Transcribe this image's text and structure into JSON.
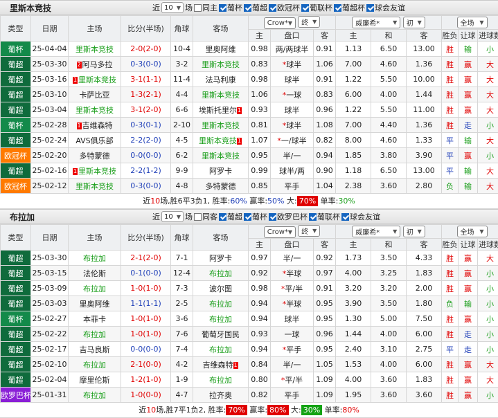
{
  "sections": [
    {
      "team": "里斯本竞技",
      "recent_label": "近",
      "recent_value": "10",
      "games_label": "场",
      "same_host": "同主",
      "leagues": [
        "葡杯",
        "葡超",
        "欧冠杯",
        "葡联杯",
        "葡超杯",
        "球会友谊"
      ],
      "league_checked": [
        true,
        true,
        true,
        true,
        true,
        true
      ],
      "same_checked": false,
      "headers": {
        "type": "类型",
        "date": "日期",
        "home": "主场",
        "score": "比分(半场)",
        "corner": "角球",
        "away": "客场",
        "win": "胜负",
        "handicap_res": "让球",
        "goals_res": "进球数",
        "crow": "Crow*",
        "crow_sel": "终",
        "will": "威廉希*",
        "will_sel": "初",
        "scope": "全场",
        "h": "主",
        "pan": "盘口",
        "k": "客",
        "zhu": "主",
        "he": "和",
        "ke": "客"
      },
      "rows": [
        {
          "type": "葡杯",
          "tc": "g-mid",
          "date": "25-04-04",
          "home": "里斯本竞技",
          "hr": "",
          "score": "2-0(2-0)",
          "sc": "r",
          "corner": "10-4",
          "away": "里奥阿维",
          "ar": "",
          "o1": "0.98",
          "pan": "两/两球半",
          "ps": false,
          "o2": "0.91",
          "w1": "1.13",
          "w2": "6.50",
          "w3": "13.00",
          "res": "胜",
          "rc": "r",
          "hd": "输",
          "hc": "gr",
          "g": "小",
          "gc": "gr",
          "hl": "home"
        },
        {
          "type": "葡超",
          "tc": "g-dark",
          "date": "25-03-30",
          "home": "阿马多拉",
          "hr": "2",
          "score": "0-3(0-0)",
          "sc": "b",
          "corner": "3-2",
          "away": "里斯本竞技",
          "ar": "",
          "o1": "0.83",
          "pan": "球半",
          "ps": true,
          "o2": "1.06",
          "w1": "7.00",
          "w2": "4.60",
          "w3": "1.36",
          "res": "胜",
          "rc": "r",
          "hd": "赢",
          "hc": "r",
          "g": "大",
          "gc": "r",
          "hl": "away"
        },
        {
          "type": "葡超",
          "tc": "g-dark",
          "date": "25-03-16",
          "home": "里斯本竞技",
          "hr": "1",
          "score": "3-1(1-1)",
          "sc": "r",
          "corner": "11-4",
          "away": "法马利康",
          "ar": "",
          "o1": "0.98",
          "pan": "球半",
          "ps": false,
          "o2": "0.91",
          "w1": "1.22",
          "w2": "5.50",
          "w3": "10.00",
          "res": "胜",
          "rc": "r",
          "hd": "赢",
          "hc": "r",
          "g": "大",
          "gc": "r",
          "hl": "home"
        },
        {
          "type": "葡超",
          "tc": "g-dark",
          "date": "25-03-10",
          "home": "卡萨比亚",
          "hr": "",
          "score": "1-3(2-1)",
          "sc": "r",
          "corner": "4-4",
          "away": "里斯本竞技",
          "ar": "",
          "o1": "1.06",
          "pan": "一球",
          "ps": true,
          "o2": "0.83",
          "w1": "6.00",
          "w2": "4.00",
          "w3": "1.44",
          "res": "胜",
          "rc": "r",
          "hd": "赢",
          "hc": "r",
          "g": "大",
          "gc": "r",
          "hl": "away"
        },
        {
          "type": "葡超",
          "tc": "g-dark",
          "date": "25-03-04",
          "home": "里斯本竞技",
          "hr": "",
          "score": "3-1(2-0)",
          "sc": "r",
          "corner": "6-6",
          "away": "埃斯托里尔",
          "ar": "1",
          "o1": "0.93",
          "pan": "球半",
          "ps": false,
          "o2": "0.96",
          "w1": "1.22",
          "w2": "5.50",
          "w3": "11.00",
          "res": "胜",
          "rc": "r",
          "hd": "赢",
          "hc": "r",
          "g": "大",
          "gc": "r",
          "hl": "home"
        },
        {
          "type": "葡杯",
          "tc": "g-mid",
          "date": "25-02-28",
          "home": "吉维森特",
          "hr": "1",
          "score": "0-3(0-1)",
          "sc": "b",
          "corner": "2-10",
          "away": "里斯本竞技",
          "ar": "",
          "o1": "0.81",
          "pan": "球半",
          "ps": true,
          "o2": "1.08",
          "w1": "7.00",
          "w2": "4.40",
          "w3": "1.36",
          "res": "胜",
          "rc": "r",
          "hd": "走",
          "hc": "b",
          "g": "小",
          "gc": "gr",
          "hl": "away"
        },
        {
          "type": "葡超",
          "tc": "g-dark",
          "date": "25-02-24",
          "home": "AVS俱乐部",
          "hr": "",
          "score": "2-2(2-0)",
          "sc": "b",
          "corner": "4-5",
          "away": "里斯本竞技",
          "ar": "1",
          "o1": "1.07",
          "pan": "一/球半",
          "ps": true,
          "o2": "0.82",
          "w1": "8.00",
          "w2": "4.60",
          "w3": "1.33",
          "res": "平",
          "rc": "b",
          "hd": "输",
          "hc": "gr",
          "g": "大",
          "gc": "r",
          "hl": "away"
        },
        {
          "type": "欧冠杯",
          "tc": "g-org",
          "date": "25-02-20",
          "home": "多特蒙德",
          "hr": "",
          "score": "0-0(0-0)",
          "sc": "b",
          "corner": "6-2",
          "away": "里斯本竞技",
          "ar": "",
          "o1": "0.95",
          "pan": "半/一",
          "ps": false,
          "o2": "0.94",
          "w1": "1.85",
          "w2": "3.80",
          "w3": "3.90",
          "res": "平",
          "rc": "b",
          "hd": "赢",
          "hc": "r",
          "g": "小",
          "gc": "gr",
          "hl": "away"
        },
        {
          "type": "葡超",
          "tc": "g-dark",
          "date": "25-02-16",
          "home": "里斯本竞技",
          "hr": "1",
          "score": "2-2(1-2)",
          "sc": "b",
          "corner": "9-9",
          "away": "阿罗卡",
          "ar": "",
          "o1": "0.99",
          "pan": "球半/两",
          "ps": false,
          "o2": "0.90",
          "w1": "1.18",
          "w2": "6.50",
          "w3": "13.00",
          "res": "平",
          "rc": "b",
          "hd": "输",
          "hc": "gr",
          "g": "大",
          "gc": "r",
          "hl": "home"
        },
        {
          "type": "欧冠杯",
          "tc": "g-org",
          "date": "25-02-12",
          "home": "里斯本竞技",
          "hr": "",
          "score": "0-3(0-0)",
          "sc": "b",
          "corner": "4-8",
          "away": "多特蒙德",
          "ar": "",
          "o1": "0.85",
          "pan": "平手",
          "ps": false,
          "o2": "1.04",
          "w1": "2.38",
          "w2": "3.60",
          "w3": "2.80",
          "res": "负",
          "rc": "gr",
          "hd": "输",
          "hc": "gr",
          "g": "大",
          "gc": "r",
          "hl": "home"
        }
      ],
      "summary": {
        "p1": "近",
        "n": "10",
        "p2": "场,胜6平3负1, 胜率:",
        "wr": "60%",
        "p3": " 赢率:",
        "yr": "50%",
        "p4": " 大:",
        "big": "70%",
        "p5": " 单率:",
        "sr": "30%"
      }
    },
    {
      "team": "布拉加",
      "recent_label": "近",
      "recent_value": "10",
      "games_label": "场",
      "same_host": "同客",
      "leagues": [
        "葡超",
        "葡杯",
        "欧罗巴杯",
        "葡联杯",
        "球会友谊"
      ],
      "league_checked": [
        true,
        true,
        true,
        true,
        true
      ],
      "same_checked": false,
      "headers": {
        "type": "类型",
        "date": "日期",
        "home": "主场",
        "score": "比分(半场)",
        "corner": "角球",
        "away": "客场",
        "win": "胜负",
        "handicap_res": "让球",
        "goals_res": "进球数",
        "crow": "Crow*",
        "crow_sel": "终",
        "will": "威廉希*",
        "will_sel": "初",
        "scope": "全场",
        "h": "主",
        "pan": "盘口",
        "k": "客",
        "zhu": "主",
        "he": "和",
        "ke": "客"
      },
      "rows": [
        {
          "type": "葡超",
          "tc": "g-dark",
          "date": "25-03-30",
          "home": "布拉加",
          "hr": "",
          "score": "2-1(2-0)",
          "sc": "r",
          "corner": "7-1",
          "away": "阿罗卡",
          "ar": "",
          "o1": "0.97",
          "pan": "半/一",
          "ps": false,
          "o2": "0.92",
          "w1": "1.73",
          "w2": "3.50",
          "w3": "4.33",
          "res": "胜",
          "rc": "r",
          "hd": "赢",
          "hc": "r",
          "g": "大",
          "gc": "r",
          "hl": "home"
        },
        {
          "type": "葡超",
          "tc": "g-dark",
          "date": "25-03-15",
          "home": "法伦斯",
          "hr": "",
          "score": "0-1(0-0)",
          "sc": "b",
          "corner": "12-4",
          "away": "布拉加",
          "ar": "",
          "o1": "0.92",
          "pan": "半球",
          "ps": true,
          "o2": "0.97",
          "w1": "4.00",
          "w2": "3.25",
          "w3": "1.83",
          "res": "胜",
          "rc": "r",
          "hd": "赢",
          "hc": "r",
          "g": "小",
          "gc": "gr",
          "hl": "away"
        },
        {
          "type": "葡超",
          "tc": "g-dark",
          "date": "25-03-09",
          "home": "布拉加",
          "hr": "",
          "score": "1-0(1-0)",
          "sc": "r",
          "corner": "7-3",
          "away": "波尔图",
          "ar": "",
          "o1": "0.98",
          "pan": "平/半",
          "ps": true,
          "o2": "0.91",
          "w1": "3.20",
          "w2": "3.20",
          "w3": "2.00",
          "res": "胜",
          "rc": "r",
          "hd": "赢",
          "hc": "r",
          "g": "小",
          "gc": "gr",
          "hl": "home"
        },
        {
          "type": "葡超",
          "tc": "g-dark",
          "date": "25-03-03",
          "home": "里奥阿维",
          "hr": "",
          "score": "1-1(1-1)",
          "sc": "b",
          "corner": "2-5",
          "away": "布拉加",
          "ar": "",
          "o1": "0.94",
          "pan": "半球",
          "ps": true,
          "o2": "0.95",
          "w1": "3.90",
          "w2": "3.50",
          "w3": "1.80",
          "res": "负",
          "rc": "gr",
          "hd": "输",
          "hc": "gr",
          "g": "小",
          "gc": "gr",
          "hl": "away"
        },
        {
          "type": "葡杯",
          "tc": "g-mid",
          "date": "25-02-27",
          "home": "本菲卡",
          "hr": "",
          "score": "1-0(1-0)",
          "sc": "r",
          "corner": "3-6",
          "away": "布拉加",
          "ar": "",
          "o1": "0.94",
          "pan": "球半",
          "ps": false,
          "o2": "0.95",
          "w1": "1.30",
          "w2": "5.00",
          "w3": "7.50",
          "res": "胜",
          "rc": "r",
          "hd": "赢",
          "hc": "r",
          "g": "小",
          "gc": "gr",
          "hl": "away"
        },
        {
          "type": "葡超",
          "tc": "g-dark",
          "date": "25-02-22",
          "home": "布拉加",
          "hr": "",
          "score": "1-0(1-0)",
          "sc": "r",
          "corner": "7-6",
          "away": "葡萄牙国民",
          "ar": "",
          "o1": "0.93",
          "pan": "一球",
          "ps": false,
          "o2": "0.96",
          "w1": "1.44",
          "w2": "4.00",
          "w3": "6.00",
          "res": "胜",
          "rc": "r",
          "hd": "走",
          "hc": "b",
          "g": "小",
          "gc": "gr",
          "hl": "home"
        },
        {
          "type": "葡超",
          "tc": "g-dark",
          "date": "25-02-17",
          "home": "吉马良斯",
          "hr": "",
          "score": "0-0(0-0)",
          "sc": "b",
          "corner": "7-4",
          "away": "布拉加",
          "ar": "",
          "o1": "0.94",
          "pan": "平手",
          "ps": true,
          "o2": "0.95",
          "w1": "2.40",
          "w2": "3.10",
          "w3": "2.75",
          "res": "平",
          "rc": "b",
          "hd": "走",
          "hc": "b",
          "g": "小",
          "gc": "gr",
          "hl": "away"
        },
        {
          "type": "葡超",
          "tc": "g-dark",
          "date": "25-02-10",
          "home": "布拉加",
          "hr": "",
          "score": "2-1(0-0)",
          "sc": "r",
          "corner": "4-2",
          "away": "吉维森特",
          "ar": "1",
          "o1": "0.84",
          "pan": "半/一",
          "ps": false,
          "o2": "1.05",
          "w1": "1.53",
          "w2": "4.00",
          "w3": "6.00",
          "res": "胜",
          "rc": "r",
          "hd": "赢",
          "hc": "r",
          "g": "大",
          "gc": "r",
          "hl": "home"
        },
        {
          "type": "葡超",
          "tc": "g-dark",
          "date": "25-02-04",
          "home": "摩里伦斯",
          "hr": "",
          "score": "1-2(1-0)",
          "sc": "r",
          "corner": "1-9",
          "away": "布拉加",
          "ar": "",
          "o1": "0.80",
          "pan": "平/半",
          "ps": true,
          "o2": "1.09",
          "w1": "4.00",
          "w2": "3.60",
          "w3": "1.83",
          "res": "胜",
          "rc": "r",
          "hd": "赢",
          "hc": "r",
          "g": "大",
          "gc": "r",
          "hl": "away"
        },
        {
          "type": "欧罗巴杯",
          "tc": "g-pur",
          "date": "25-01-31",
          "home": "布拉加",
          "hr": "",
          "score": "1-0(0-0)",
          "sc": "r",
          "corner": "4-7",
          "away": "拉齐奥",
          "ar": "",
          "o1": "0.82",
          "pan": "平手",
          "ps": false,
          "o2": "1.09",
          "w1": "1.95",
          "w2": "3.60",
          "w3": "3.60",
          "res": "胜",
          "rc": "r",
          "hd": "赢",
          "hc": "r",
          "g": "小",
          "gc": "gr",
          "hl": "home"
        }
      ],
      "summary": {
        "p1": "近",
        "n": "10",
        "p2": "场,胜7平1负2, 胜率:",
        "wr": "70%",
        "p3": " 赢率:",
        "yr": "80%",
        "p4": " 大:",
        "big": "30%",
        "p5": " 单率:",
        "sr": "80%"
      }
    }
  ],
  "colors": {
    "win": "#e00000",
    "draw": "#1f3fb8",
    "loss": "#1a9e1a",
    "highlight": "#1a9e1a",
    "league_dark": "#0f6b3c",
    "league_mid": "#138a4a",
    "league_orange": "#ff7a00",
    "league_purple": "#8a1fd6"
  }
}
